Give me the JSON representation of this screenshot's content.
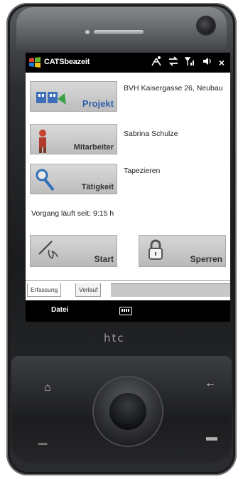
{
  "titlebar": {
    "app_title": "CATSbeazeit",
    "close_label": "×"
  },
  "tiles": [
    {
      "label": "Projekt",
      "icon": "project-icon",
      "info": "BVH Kaisergasse 26, Neubau"
    },
    {
      "label": "Mitarbeiter",
      "icon": "worker-icon",
      "info": "Sabrina Schulze"
    },
    {
      "label": "Tätigkeit",
      "icon": "activity-icon",
      "info": "Tapezieren"
    }
  ],
  "status_line": "Vorgang läuft seit: 9:15 h",
  "buttons": {
    "start_label": "Start",
    "lock_label": "Sperren"
  },
  "tabs": [
    {
      "label": "Erfassung",
      "active": true
    },
    {
      "label": "Verlauf",
      "active": false
    }
  ],
  "softbar": {
    "left_label": "Datei",
    "center_icon": "keyboard-icon"
  },
  "device": {
    "brand": "htc"
  },
  "colors": {
    "titlebar_bg": "#000000",
    "tile_bg": "#c8c8c8",
    "project_blue": "#2f5fa8",
    "label_dark": "#333333"
  }
}
